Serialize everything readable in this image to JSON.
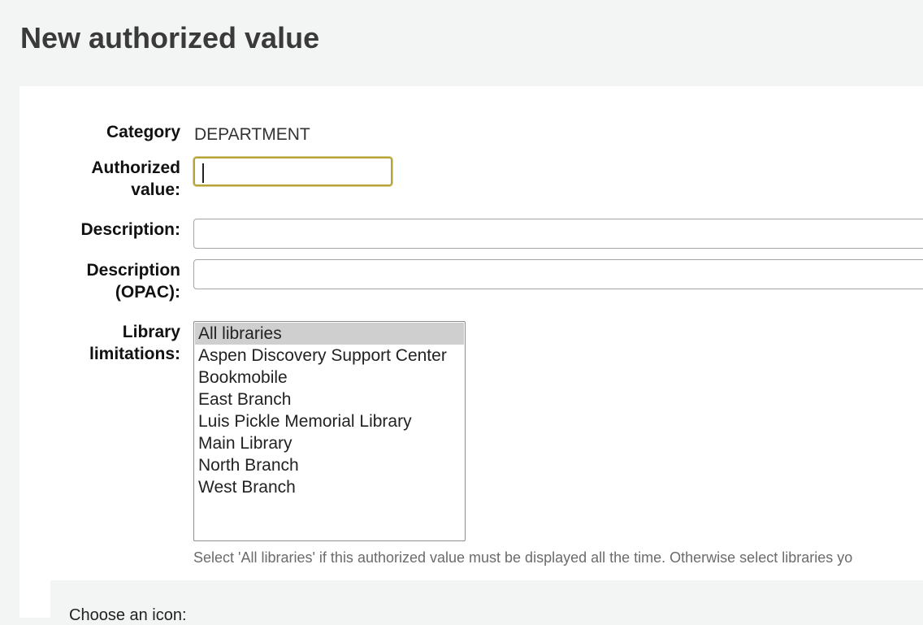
{
  "page": {
    "title": "New authorized value"
  },
  "form": {
    "category_label": "Category",
    "category_value": "DEPARTMENT",
    "authorized_value_label": "Authorized value:",
    "authorized_value_value": "",
    "description_label": "Description:",
    "description_value": "",
    "description_opac_label": "Description (OPAC):",
    "description_opac_value": "",
    "library_limitations_label": "Library limitations:",
    "library_options": [
      "All libraries",
      "Aspen Discovery Support Center",
      "Bookmobile",
      "East Branch",
      "Luis Pickle Memorial Library",
      "Main Library",
      "North Branch",
      "West Branch"
    ],
    "library_selected": "All libraries",
    "library_hint": "Select 'All libraries' if this authorized value must be displayed all the time. Otherwise select libraries yo"
  },
  "icon_section": {
    "heading": "Choose an icon:"
  }
}
